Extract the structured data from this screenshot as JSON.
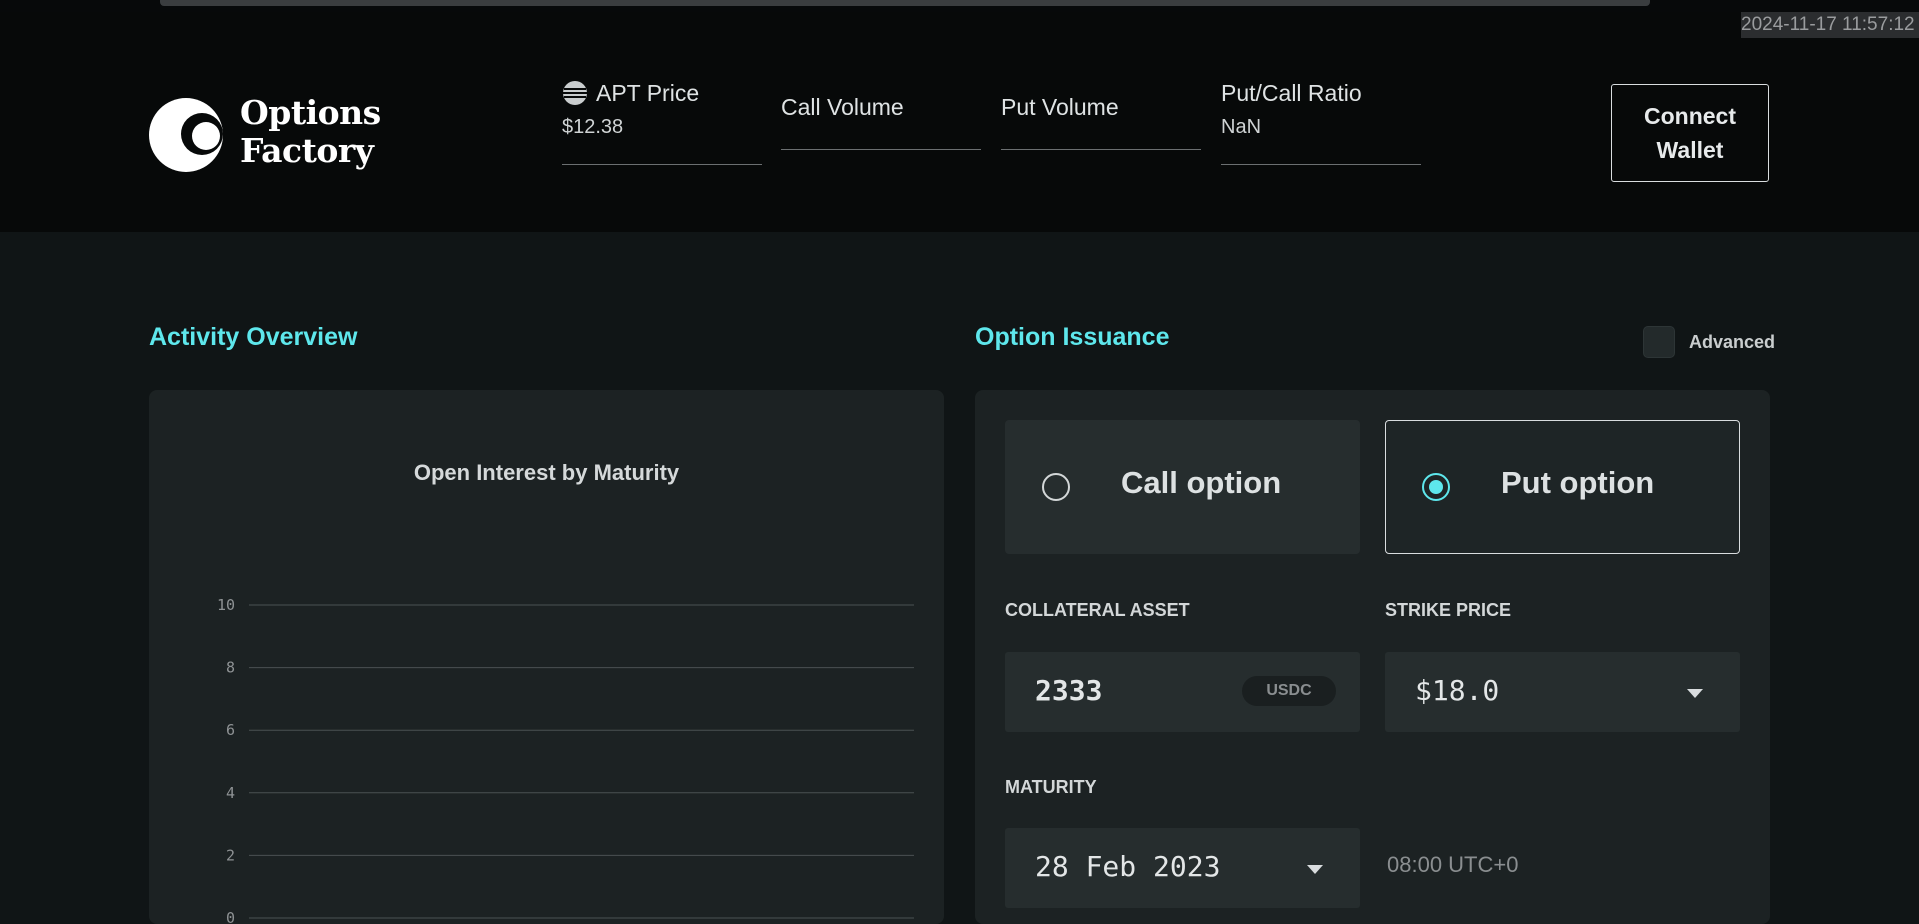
{
  "timestamp": "2024-11-17 11:57:12",
  "header": {
    "logo_line1": "Options",
    "logo_line2": "Factory",
    "stats": [
      {
        "label": "APT Price",
        "value": "$12.38",
        "icon": "aptos-icon"
      },
      {
        "label": "Call Volume",
        "value": ""
      },
      {
        "label": "Put Volume",
        "value": ""
      },
      {
        "label": "Put/Call Ratio",
        "value": "NaN"
      }
    ],
    "connect_label": "Connect\nWallet"
  },
  "activity": {
    "title": "Activity Overview",
    "chart_title": "Open Interest by Maturity"
  },
  "chart_data": {
    "type": "bar",
    "title": "Open Interest by Maturity",
    "categories": [],
    "values": [],
    "ylim": [
      0,
      10
    ],
    "yticks": [
      "10",
      "8",
      "6",
      "4",
      "2",
      "0"
    ],
    "grid": true
  },
  "issuance": {
    "title": "Option Issuance",
    "advanced_label": "Advanced",
    "call_label": "Call option",
    "put_label": "Put option",
    "selected": "Put option",
    "collateral_label": "COLLATERAL ASSET",
    "collateral_value": "2333",
    "collateral_unit": "USDC",
    "strike_label": "STRIKE PRICE",
    "strike_value": "$18.0",
    "maturity_label": "MATURITY",
    "maturity_value": "28 Feb 2023",
    "maturity_time": "08:00 UTC+0"
  },
  "colors": {
    "accent": "#5ee7ec",
    "background": "#101516",
    "panel": "#1c2223"
  }
}
